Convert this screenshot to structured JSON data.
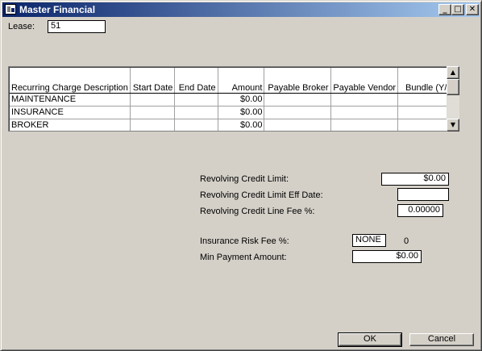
{
  "window": {
    "title": "Master Financial",
    "minimize_glyph": "_",
    "maximize_glyph": "□",
    "close_glyph": "✕"
  },
  "lease": {
    "label": "Lease:",
    "value": "51"
  },
  "grid": {
    "columns": [
      "Recurring Charge Description",
      "Start Date",
      "End Date",
      "Amount",
      "Payable Broker",
      "Payable Vendor",
      "Bundle (Y/N)"
    ],
    "rows": [
      {
        "description": "MAINTENANCE",
        "start_date": "",
        "end_date": "",
        "amount": "$0.00",
        "payable_broker": "",
        "payable_vendor": "",
        "bundle": ""
      },
      {
        "description": "INSURANCE",
        "start_date": "",
        "end_date": "",
        "amount": "$0.00",
        "payable_broker": "",
        "payable_vendor": "",
        "bundle": ""
      },
      {
        "description": "BROKER",
        "start_date": "",
        "end_date": "",
        "amount": "$0.00",
        "payable_broker": "",
        "payable_vendor": "",
        "bundle": ""
      }
    ],
    "scroll_up_glyph": "▲",
    "scroll_down_glyph": "▼"
  },
  "credit": {
    "limit_label": "Revolving Credit Limit:",
    "limit_value": "$0.00",
    "eff_date_label": "Revolving Credit Limit Eff Date:",
    "eff_date_value": "",
    "line_fee_label": "Revolving Credit Line Fee %:",
    "line_fee_value": "0.00000"
  },
  "insurance": {
    "risk_fee_label": "Insurance Risk Fee %:",
    "risk_fee_value": "NONE",
    "risk_fee_amount": "0",
    "min_payment_label": "Min Payment Amount:",
    "min_payment_value": "$0.00"
  },
  "buttons": {
    "ok": "OK",
    "cancel": "Cancel"
  }
}
